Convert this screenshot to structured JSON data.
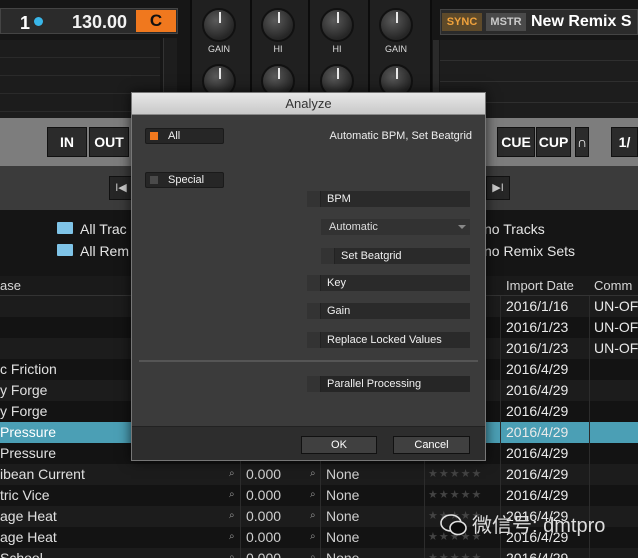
{
  "deck_a": {
    "number": "1",
    "bpm": "130.00",
    "key": "C"
  },
  "mixer": {
    "knob_labels": [
      "GAIN",
      "HI",
      "HI",
      "GAIN"
    ]
  },
  "deck_b": {
    "sync_label": "SYNC",
    "master_label": "MSTR",
    "title": "New Remix S"
  },
  "transport": {
    "in_label": "IN",
    "out_label": "OUT",
    "cue_label": "CUE",
    "cup_label": "CUP",
    "skip_back": "I◀",
    "skip_fwd": "▶I",
    "loop_label": "∩",
    "page_label": "1/"
  },
  "browser": {
    "favorites": [
      {
        "left": "All Trac",
        "right": "no Tracks"
      },
      {
        "left": "All Rem",
        "right": "no Remix Sets"
      }
    ],
    "columns": {
      "release": "ase",
      "import_date": "Import Date",
      "comment": "Comm"
    },
    "rows": [
      {
        "name": "",
        "bpm": "",
        "key": "",
        "date": "2016/1/16",
        "comment": "UN-OF",
        "state": "even"
      },
      {
        "name": "",
        "bpm": "",
        "key": "",
        "date": "2016/1/23",
        "comment": "UN-OF",
        "state": "odd"
      },
      {
        "name": "",
        "bpm": "",
        "key": "",
        "date": "2016/1/23",
        "comment": "UN-OF",
        "state": "even"
      },
      {
        "name": "c Friction",
        "bpm": "",
        "key": "",
        "date": "2016/4/29",
        "comment": "",
        "state": "odd"
      },
      {
        "name": "y Forge",
        "bpm": "",
        "key": "",
        "date": "2016/4/29",
        "comment": "",
        "state": "even"
      },
      {
        "name": "y Forge",
        "bpm": "",
        "key": "",
        "date": "2016/4/29",
        "comment": "",
        "state": "odd"
      },
      {
        "name": "Pressure",
        "bpm": "",
        "key": "",
        "date": "2016/4/29",
        "comment": "",
        "state": "sel"
      },
      {
        "name": "Pressure",
        "bpm": "",
        "key": "",
        "date": "2016/4/29",
        "comment": "",
        "state": "odd"
      },
      {
        "name": "ibean Current",
        "bpm": "0.000",
        "key": "None",
        "date": "2016/4/29",
        "comment": "",
        "state": "even"
      },
      {
        "name": "tric Vice",
        "bpm": "0.000",
        "key": "None",
        "date": "2016/4/29",
        "comment": "",
        "state": "odd"
      },
      {
        "name": "age Heat",
        "bpm": "0.000",
        "key": "None",
        "date": "2016/4/29",
        "comment": "",
        "state": "even"
      },
      {
        "name": "age Heat",
        "bpm": "0.000",
        "key": "None",
        "date": "2016/4/29",
        "comment": "",
        "state": "odd"
      },
      {
        "name": "School",
        "bpm": "0.000",
        "key": "None",
        "date": "2016/4/29",
        "comment": "",
        "state": "even"
      }
    ],
    "stars": "★★★★★"
  },
  "dialog": {
    "title": "Analyze",
    "all_label": "All",
    "all_description": "Automatic BPM, Set Beatgrid",
    "special_label": "Special",
    "bpm_label": "BPM",
    "bpm_mode": "Automatic",
    "set_beatgrid_label": "Set Beatgrid",
    "key_label": "Key",
    "gain_label": "Gain",
    "replace_locked_label": "Replace Locked Values",
    "parallel_label": "Parallel Processing",
    "ok_label": "OK",
    "cancel_label": "Cancel"
  },
  "watermark": {
    "text": "微信号: dmtpro"
  },
  "colors": {
    "accent": "#f0781e",
    "selection": "#4b9fb5",
    "deck_dot": "#39b6e8"
  }
}
